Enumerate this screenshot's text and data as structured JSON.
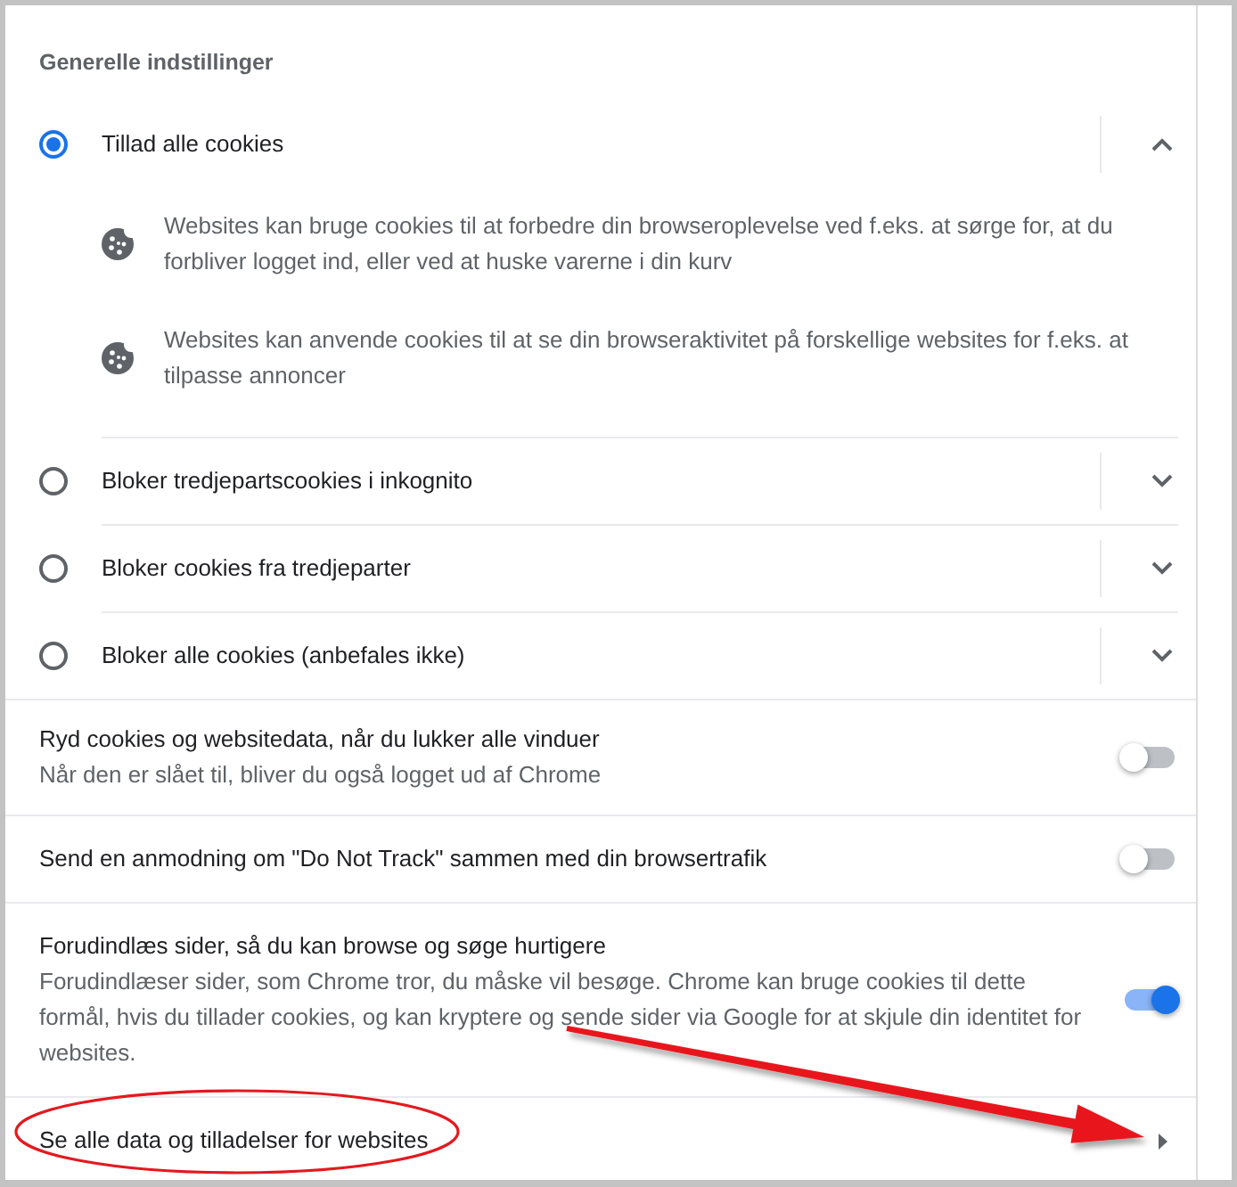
{
  "section": {
    "title": "Generelle indstillinger"
  },
  "cookie_options": [
    {
      "label": "Tillad alle cookies",
      "selected": true,
      "expanded": true,
      "details": [
        "Websites kan bruge cookies til at forbedre din browseroplevelse ved f.eks. at sørge for, at du forbliver logget ind, eller ved at huske varerne i din kurv",
        "Websites kan anvende cookies til at se din browseraktivitet på forskellige websites for f.eks. at tilpasse annoncer"
      ]
    },
    {
      "label": "Bloker tredjepartscookies i inkognito",
      "selected": false,
      "expanded": false
    },
    {
      "label": "Bloker cookies fra tredjeparter",
      "selected": false,
      "expanded": false
    },
    {
      "label": "Bloker alle cookies (anbefales ikke)",
      "selected": false,
      "expanded": false
    }
  ],
  "toggles": [
    {
      "label": "Ryd cookies og websitedata, når du lukker alle vinduer",
      "description": "Når den er slået til, bliver du også logget ud af Chrome",
      "on": false
    },
    {
      "label": "Send en anmodning om \"Do Not Track\" sammen med din browsertrafik",
      "on": false
    },
    {
      "label": "Forudindlæs sider, så du kan browse og søge hurtigere",
      "description": "Forudindlæser sider, som Chrome tror, du måske vil besøge. Chrome kan bruge cookies til dette formål, hvis du tillader cookies, og kan kryptere og sende sider via Google for at skjule din identitet for websites.",
      "on": true
    }
  ],
  "link_row": {
    "label": "Se alle data og tilladelser for websites"
  }
}
